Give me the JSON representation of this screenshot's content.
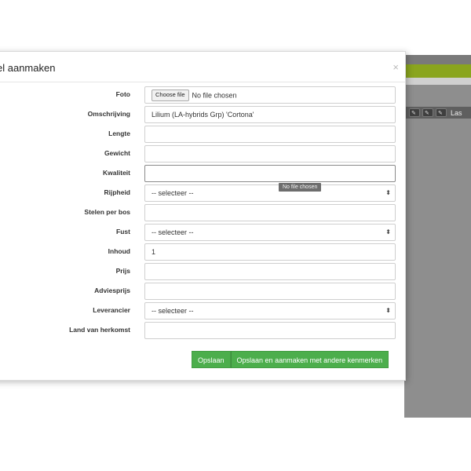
{
  "modal": {
    "title": "el aanmaken",
    "close": "×"
  },
  "form": {
    "foto": {
      "label": "Foto",
      "file_button": "Choose file",
      "file_status": "No file chosen"
    },
    "omschrijving": {
      "label": "Omschrijving",
      "value": "Lilium (LA-hybrids Grp) 'Cortona'"
    },
    "lengte": {
      "label": "Lengte",
      "value": ""
    },
    "gewicht": {
      "label": "Gewicht",
      "value": ""
    },
    "kwaliteit": {
      "label": "Kwaliteit",
      "value": ""
    },
    "rijpheid": {
      "label": "Rijpheid",
      "selected": "-- selecteer --"
    },
    "stelen_per_bos": {
      "label": "Stelen per bos",
      "value": ""
    },
    "fust": {
      "label": "Fust",
      "selected": "-- selecteer --"
    },
    "inhoud": {
      "label": "Inhoud",
      "value": "1"
    },
    "prijs": {
      "label": "Prijs",
      "value": ""
    },
    "adviesprijs": {
      "label": "Adviesprijs",
      "value": ""
    },
    "leverancier": {
      "label": "Leverancier",
      "selected": "-- selecteer --"
    },
    "land_van_herkomst": {
      "label": "Land van herkomst",
      "value": ""
    }
  },
  "tooltip": "No file chosen",
  "actions": {
    "save": "Opslaan",
    "save_and_new": "Opslaan en aanmaken met andere kenmerken"
  },
  "background": {
    "toolbar_label": "Las"
  },
  "colors": {
    "primary_green": "#4cae4c",
    "bg_green_bar": "#8aa51e",
    "overlay_gray": "#8e8e8e"
  }
}
